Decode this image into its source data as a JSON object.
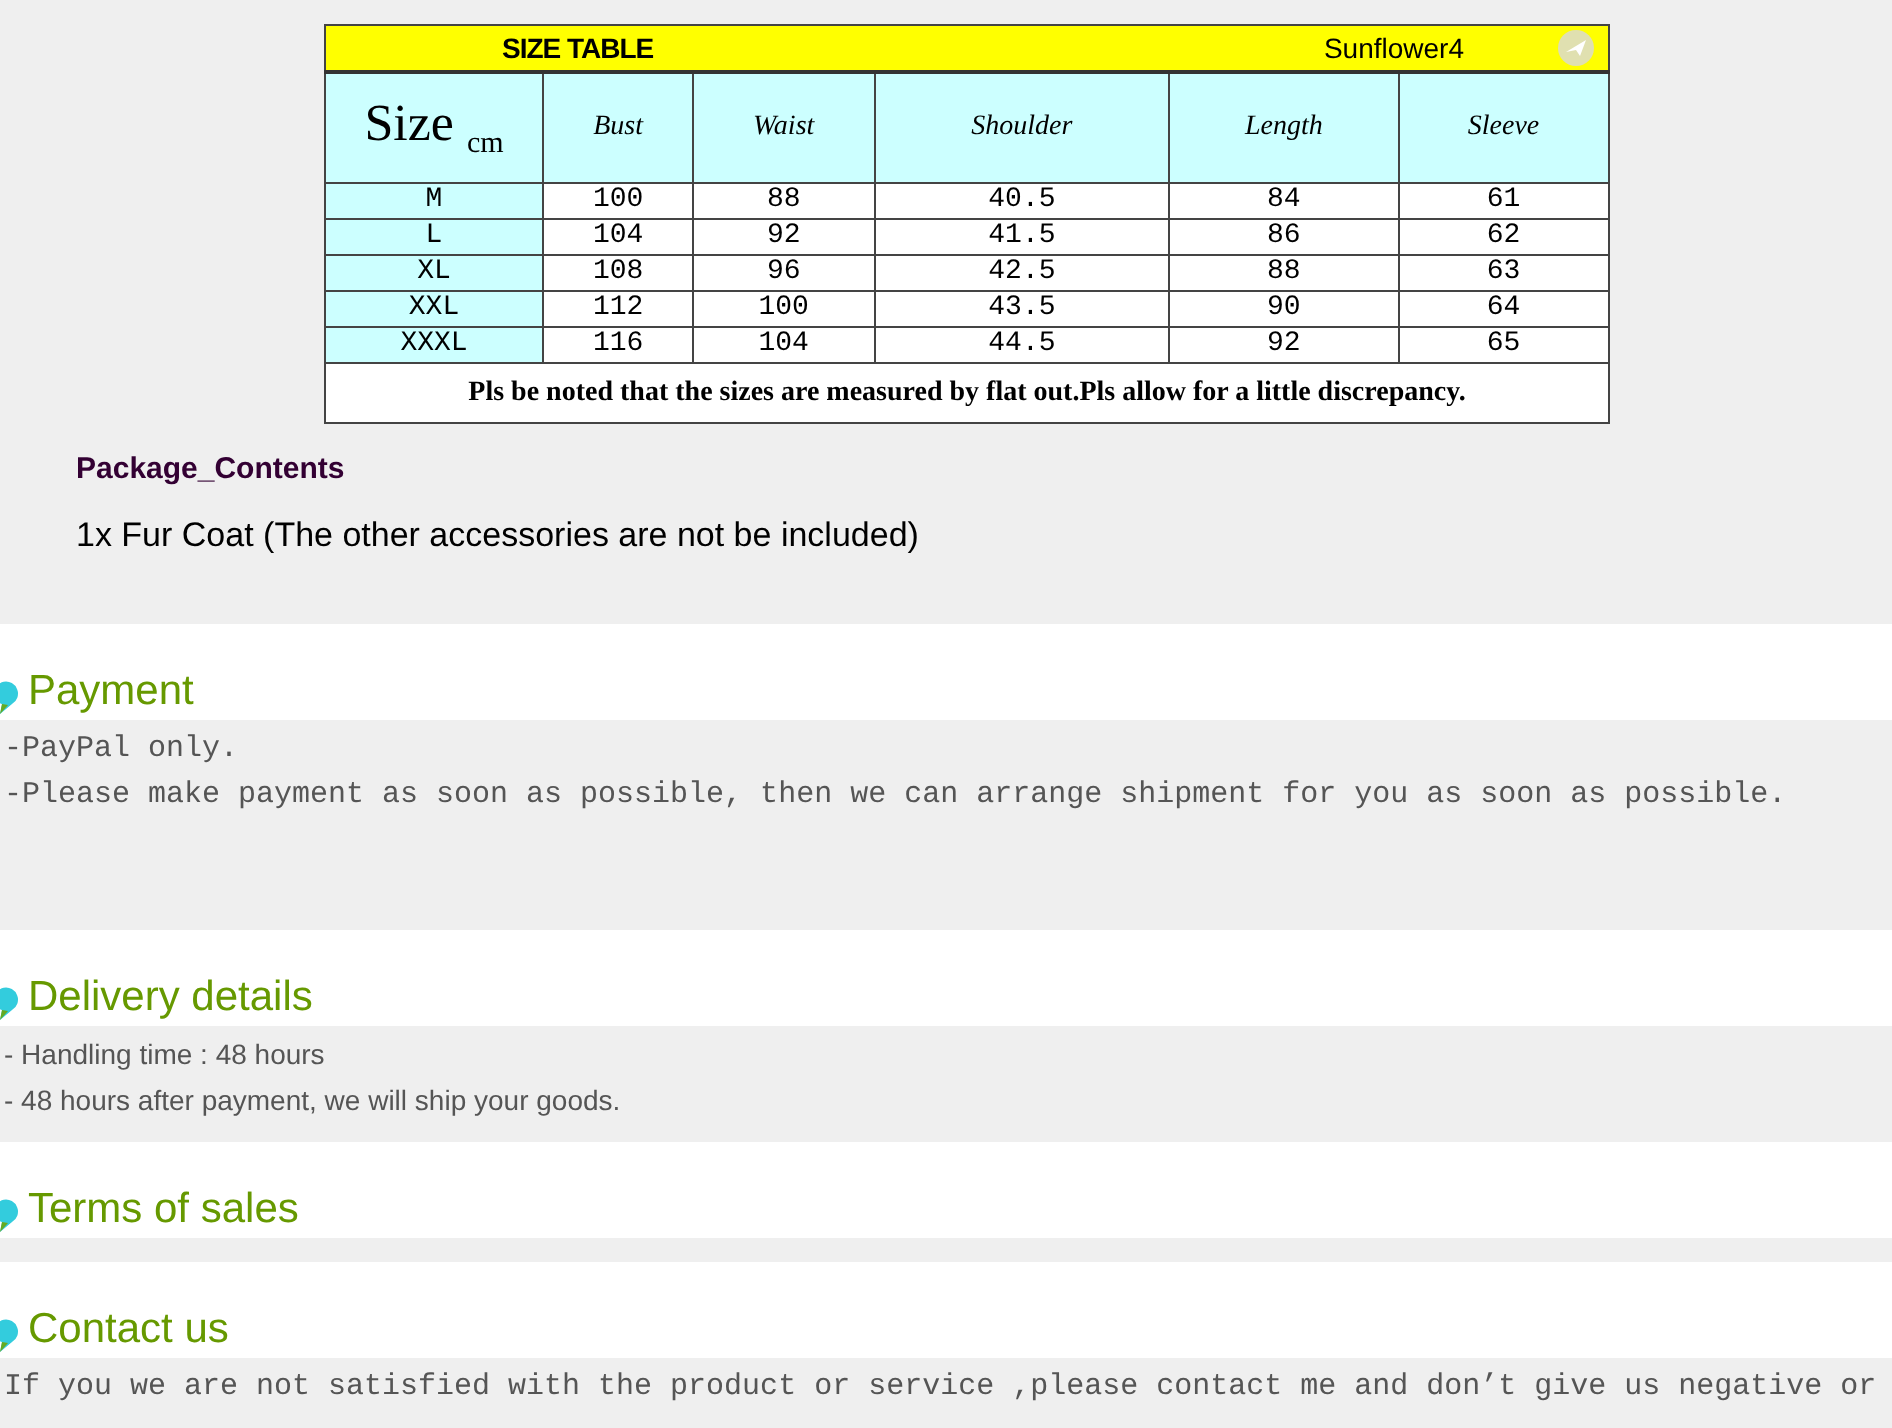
{
  "size_table": {
    "title": "SIZE TABLE",
    "brand": "Sunflower4",
    "columns": [
      "Size $_{cm}$",
      "Bust",
      "Waist",
      "Shoulder",
      "Length",
      "Sleeve"
    ],
    "rows": [
      [
        "M",
        "100",
        "88",
        "40.5",
        "84",
        "61"
      ],
      [
        "L",
        "104",
        "92",
        "41.5",
        "86",
        "62"
      ],
      [
        "XL",
        "108",
        "96",
        "42.5",
        "88",
        "63"
      ],
      [
        "XXL",
        "112",
        "100",
        "43.5",
        "90",
        "64"
      ],
      [
        "XXXL",
        "116",
        "104",
        "44.5",
        "92",
        "65"
      ]
    ],
    "note": "Pls be noted that the sizes are measured by flat out.Pls allow for a little discrepancy."
  },
  "package": {
    "heading": "Package_Contents",
    "text": "1x Fur Coat (The other accessories are not be included)"
  },
  "sections": [
    {
      "title": "Payment",
      "kind": "mono",
      "lines": [
        "-PayPal only.",
        "-Please make payment as soon as possible, then we can arrange shipment for you as soon as possible."
      ]
    },
    {
      "title": "Delivery details",
      "kind": "sans",
      "lines": [
        "- Handling time : 48 hours",
        "- 48 hours after payment, we will ship your goods."
      ]
    },
    {
      "title": "Terms of sales"
    },
    {
      "title": "Contact us",
      "kind": "mono",
      "lines": [
        "If you we are not satisfied with the product or service ,please contact me and don’t give us negative or"
      ]
    }
  ]
}
